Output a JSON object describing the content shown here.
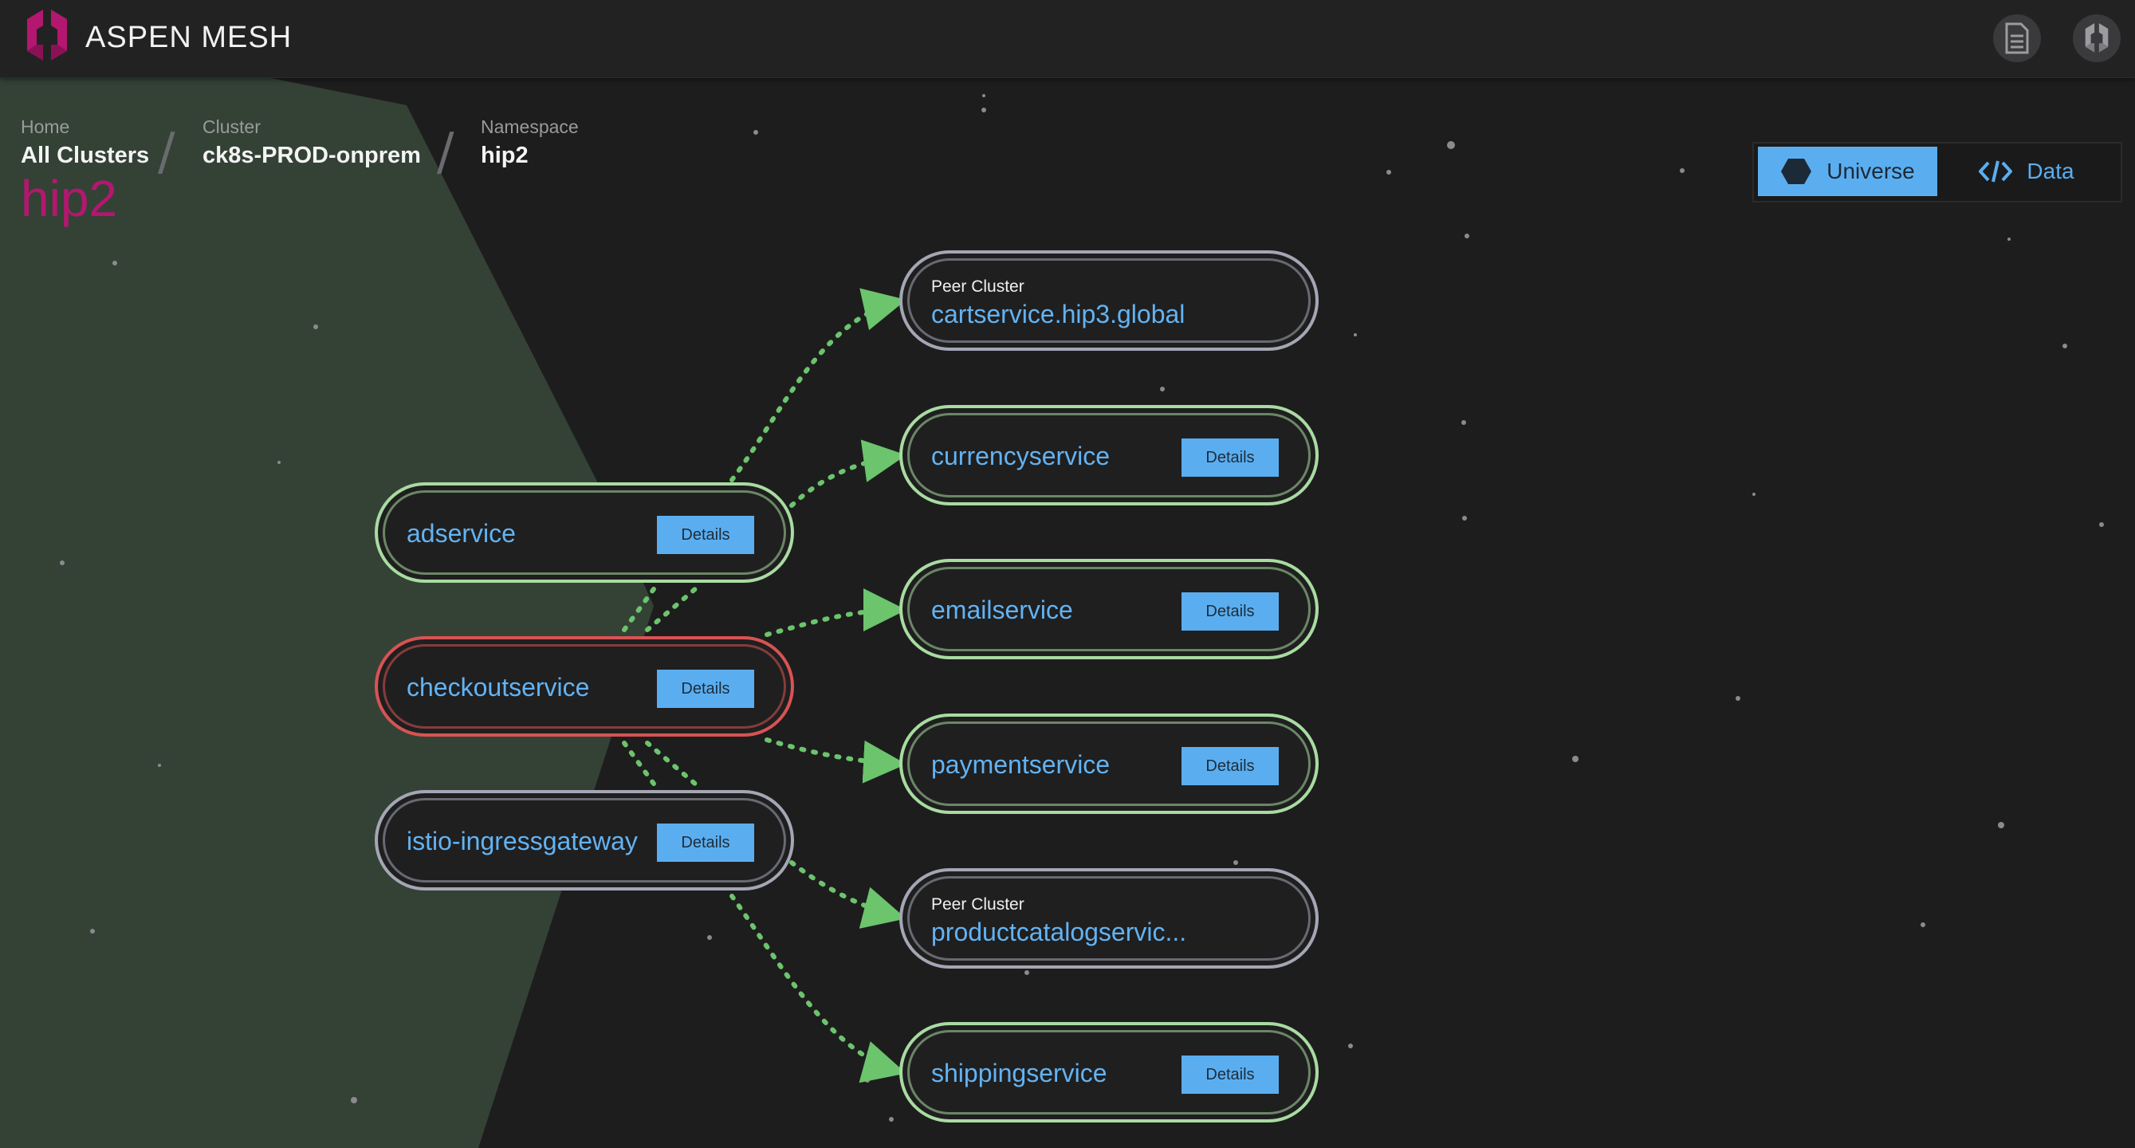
{
  "brand": {
    "name": "ASPEN MESH"
  },
  "header_icons": {
    "docs_icon": "document-icon",
    "account_icon": "aspen-logo-icon"
  },
  "breadcrumb": [
    {
      "kicker": "Home",
      "value": "All Clusters"
    },
    {
      "kicker": "Cluster",
      "value": "ck8s-PROD-onprem"
    },
    {
      "kicker": "Namespace",
      "value": "hip2"
    }
  ],
  "page_title": "hip2",
  "view_toggle": {
    "universe_label": "Universe",
    "data_label": "Data",
    "selected": "Universe"
  },
  "colors": {
    "accent": "#5aaef0",
    "brand_magenta": "#b4176f",
    "healthy": "#a9dba1",
    "error": "#d85353",
    "neutral": "#a4a6b4",
    "edge": "#6cc46c"
  },
  "services": {
    "adservice": {
      "name": "adservice",
      "details_label": "Details",
      "status": "healthy"
    },
    "checkoutservice": {
      "name": "checkoutservice",
      "details_label": "Details",
      "status": "error"
    },
    "istio_ingressgateway": {
      "name": "istio-ingressgateway",
      "details_label": "Details",
      "status": "gateway"
    },
    "cartservice": {
      "kicker": "Peer Cluster",
      "name": "cartservice.hip3.global",
      "status": "peer"
    },
    "currencyservice": {
      "name": "currencyservice",
      "details_label": "Details",
      "status": "healthy"
    },
    "emailservice": {
      "name": "emailservice",
      "details_label": "Details",
      "status": "healthy"
    },
    "paymentservice": {
      "name": "paymentservice",
      "details_label": "Details",
      "status": "healthy"
    },
    "productcatalogservice": {
      "kicker": "Peer Cluster",
      "name": "productcatalogservic...",
      "status": "peer"
    },
    "shippingservice": {
      "name": "shippingservice",
      "details_label": "Details",
      "status": "healthy"
    }
  }
}
